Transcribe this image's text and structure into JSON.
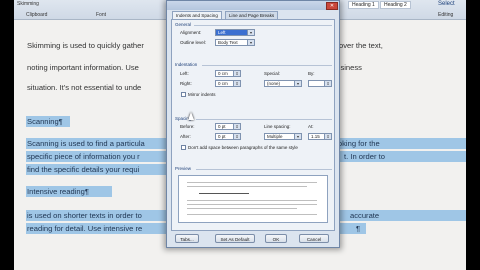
{
  "ribbon": {
    "left_top": "Skimming",
    "clipboard": "Clipboard",
    "font": "Font",
    "heading1": "Heading 1",
    "heading2": "Heading 2",
    "select": "Select",
    "editing": "Editing"
  },
  "document": {
    "lines": [
      "Skimming is used to quickly gather",
      "over the text,",
      "noting important information. Use",
      "business",
      "situation. It’s not essential to unde"
    ],
    "highlighted": [
      "Scanning¶",
      "Scanning is used to find a particula",
      "looking for the",
      "specific piece of information you r",
      "t. In order to",
      "find the specific details your requi",
      "Intensive reading¶",
      "is used on shorter texts in order to",
      "accurate",
      "reading for detail. Use intensive re",
      "¶"
    ]
  },
  "dialog": {
    "tabs": [
      "Indents and Spacing",
      "Line and Page Breaks"
    ],
    "general": {
      "section": "General",
      "alignment_label": "Alignment:",
      "alignment_value": "Left",
      "outline_label": "Outline level:",
      "outline_value": "Body Text"
    },
    "indentation": {
      "section": "Indentation",
      "left_label": "Left:",
      "left_value": "0 cm",
      "right_label": "Right:",
      "right_value": "0 cm",
      "special_label": "Special:",
      "special_value": "(none)",
      "by_label": "By:",
      "mirror_label": "Mirror indents"
    },
    "spacing": {
      "section": "Spacing",
      "before_label": "Before:",
      "before_value": "0 pt",
      "after_label": "After:",
      "after_value": "0 pt",
      "line_label": "Line spacing:",
      "line_value": "Multiple",
      "at_label": "At:",
      "at_value": "1.15",
      "dont_add_label": "Don't add space between paragraphs of the same style"
    },
    "preview": {
      "section": "Preview"
    },
    "buttons": {
      "tabs": "Tabs...",
      "default": "Set As Default",
      "ok": "OK",
      "cancel": "Cancel"
    }
  },
  "colors": {
    "highlight": "#9fc6e6",
    "dialog_bg": "#dbe4ef",
    "section_text": "#1d3f78"
  }
}
